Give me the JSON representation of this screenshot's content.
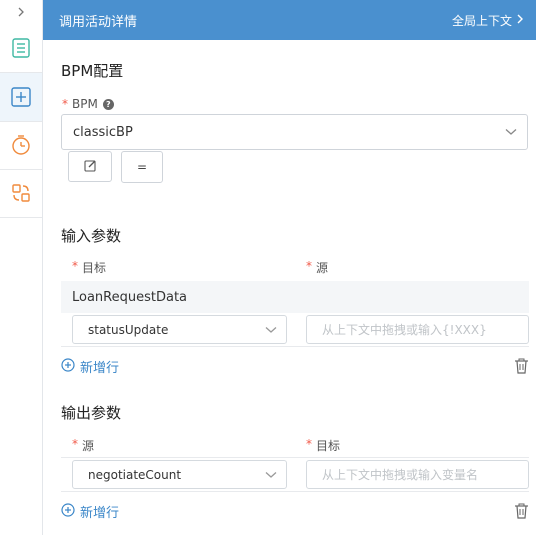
{
  "header": {
    "title": "调用活动详情",
    "context_link": "全局上下文"
  },
  "bpm_config": {
    "section_title": "BPM配置",
    "field_label": "BPM",
    "required_mark": "*",
    "selected_value": "classicBP",
    "edit_icon": "edit-icon",
    "equals_label": "="
  },
  "input_params": {
    "section_title": "输入参数",
    "columns": [
      "目标",
      "源"
    ],
    "group_label": "LoanRequestData",
    "rows": [
      {
        "target": "statusUpdate",
        "source_placeholder": "从上下文中拖拽或输入{!XXX}"
      }
    ],
    "add_row_label": "新增行"
  },
  "output_params": {
    "section_title": "输出参数",
    "columns": [
      "源",
      "目标"
    ],
    "rows": [
      {
        "source": "negotiateCount",
        "target_placeholder": "从上下文中拖拽或输入变量名"
      }
    ],
    "add_row_label": "新增行"
  },
  "colors": {
    "header_bg": "#4a90cf",
    "accent": "#3a86c8",
    "icon_green": "#3fb8a3",
    "icon_orange": "#f08a3c",
    "required": "#f15a4a"
  }
}
